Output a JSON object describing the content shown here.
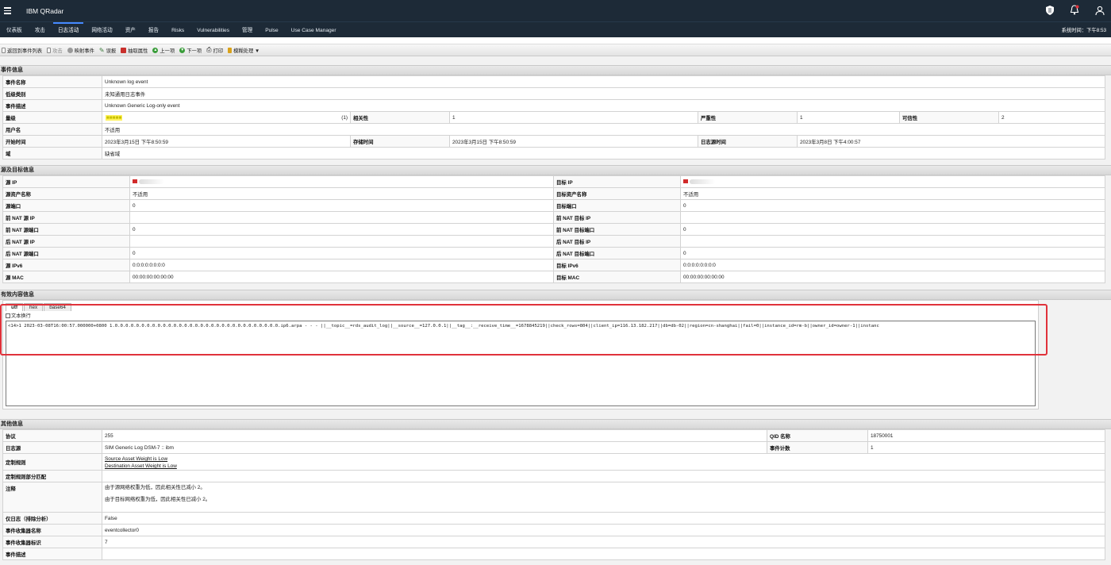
{
  "app": {
    "title": "IBM QRadar"
  },
  "nav": {
    "tabs": [
      "仪表板",
      "攻击",
      "日志活动",
      "网络活动",
      "资产",
      "报告",
      "Risks",
      "Vulnerabilities",
      "管理",
      "Pulse",
      "Use Case Manager"
    ],
    "active": "日志活动",
    "sys_time_label": "系统时间：",
    "sys_time_value": "下午8:53"
  },
  "toolbar": {
    "back": "返回到事件列表",
    "offense": "攻击",
    "map_event": "映射事件",
    "false_positive": "误报",
    "extract_property": "抽取属性",
    "prev": "上一项",
    "next": "下一项",
    "print": "打印",
    "obfuscation": "模糊处理 ▼"
  },
  "event_info": {
    "header": "事件信息",
    "event_name_label": "事件名称",
    "event_name": "Unknown log event",
    "low_level_label": "低级类别",
    "low_level": "未知通用日志事件",
    "desc_label": "事件描述",
    "desc": "Unknown Generic Log-only event",
    "magnitude_label": "量级",
    "magnitude_bar": "■■■■■",
    "magnitude_value": "(1)",
    "relevance_label": "相关性",
    "relevance": "1",
    "severity_label": "严重性",
    "severity": "1",
    "credibility_label": "可信性",
    "credibility": "2",
    "username_label": "用户名",
    "username": "不适用",
    "start_label": "开始时间",
    "start": "2023年3月15日 下午8:50:59",
    "storage_label": "存储时间",
    "storage": "2023年3月15日 下午8:50:59",
    "logsrc_time_label": "日志源时间",
    "logsrc_time": "2023年3月8日 下午4:00:57",
    "domain_label": "域",
    "domain": "缺省域"
  },
  "src_dst": {
    "header": "源及目标信息",
    "rows": [
      [
        "源 IP",
        "",
        "目标 IP",
        ""
      ],
      [
        "源资产名称",
        "不适用",
        "目标资产名称",
        "不适用"
      ],
      [
        "源端口",
        "0",
        "目标端口",
        "0"
      ],
      [
        "前 NAT 源 IP",
        "",
        "前 NAT 目标 IP",
        ""
      ],
      [
        "前 NAT 源端口",
        "0",
        "前 NAT 目标端口",
        "0"
      ],
      [
        "后 NAT 源 IP",
        "",
        "后 NAT 目标 IP",
        ""
      ],
      [
        "后 NAT 源端口",
        "0",
        "后 NAT 目标端口",
        "0"
      ],
      [
        "源 IPv6",
        "0:0:0:0:0:0:0:0",
        "目标 IPv6",
        "0:0:0:0:0:0:0:0"
      ],
      [
        "源 MAC",
        "00:00:00:00:00:00",
        "目标 MAC",
        "00:00:00:00:00:00"
      ]
    ]
  },
  "payload": {
    "header": "有效内容信息",
    "tabs": [
      "utf",
      "hex",
      "base64"
    ],
    "wrap_label": "文本换行",
    "text": "<14>1 2023-03-08T16:00:57.000000+0800 1.0.0.0.0.0.0.0.0.0.0.0.0.0.0.0.0.0.0.0.0.0.0.0.0.0.0.0.0.0.0.0.ip6.arpa - - - ||__topic__=rds_audit_log||__source__=127.0.0.1||__tag__:__receive_time__=1678845219||check_rows=804||client_ip=116.13.182.217||db=db-02||region=cn-shanghai||fail=0||instance_id=rm-b||owner_id=owner-1||instanc"
  },
  "other": {
    "header": "其他信息",
    "protocol_label": "协议",
    "protocol": "255",
    "qid_label": "QID 名称",
    "qid": "18750001",
    "logsource_label": "日志源",
    "logsource": "SIM Generic Log DSM-7 :: ibm",
    "event_count_label": "事件计数",
    "event_count": "1",
    "custom_rules_label": "定制规则",
    "custom_rules": [
      "Source Asset Weight is Low",
      "Destination Asset Weight is Low"
    ],
    "partial_match_label": "定制规则部分匹配",
    "partial_match": "",
    "notes_label": "注释",
    "notes": [
      "由于源网络权重为低，因此相关性已减小 2。",
      "由于目标网络权重为低，因此相关性已减小 2。"
    ],
    "log_only_label": "仅日志（排除分析）",
    "log_only": "False",
    "collector_name_label": "事件收集器名称",
    "collector_name": "eventcollector0",
    "collector_id_label": "事件收集器标识",
    "collector_id": "7",
    "next_label": "事件描述"
  }
}
